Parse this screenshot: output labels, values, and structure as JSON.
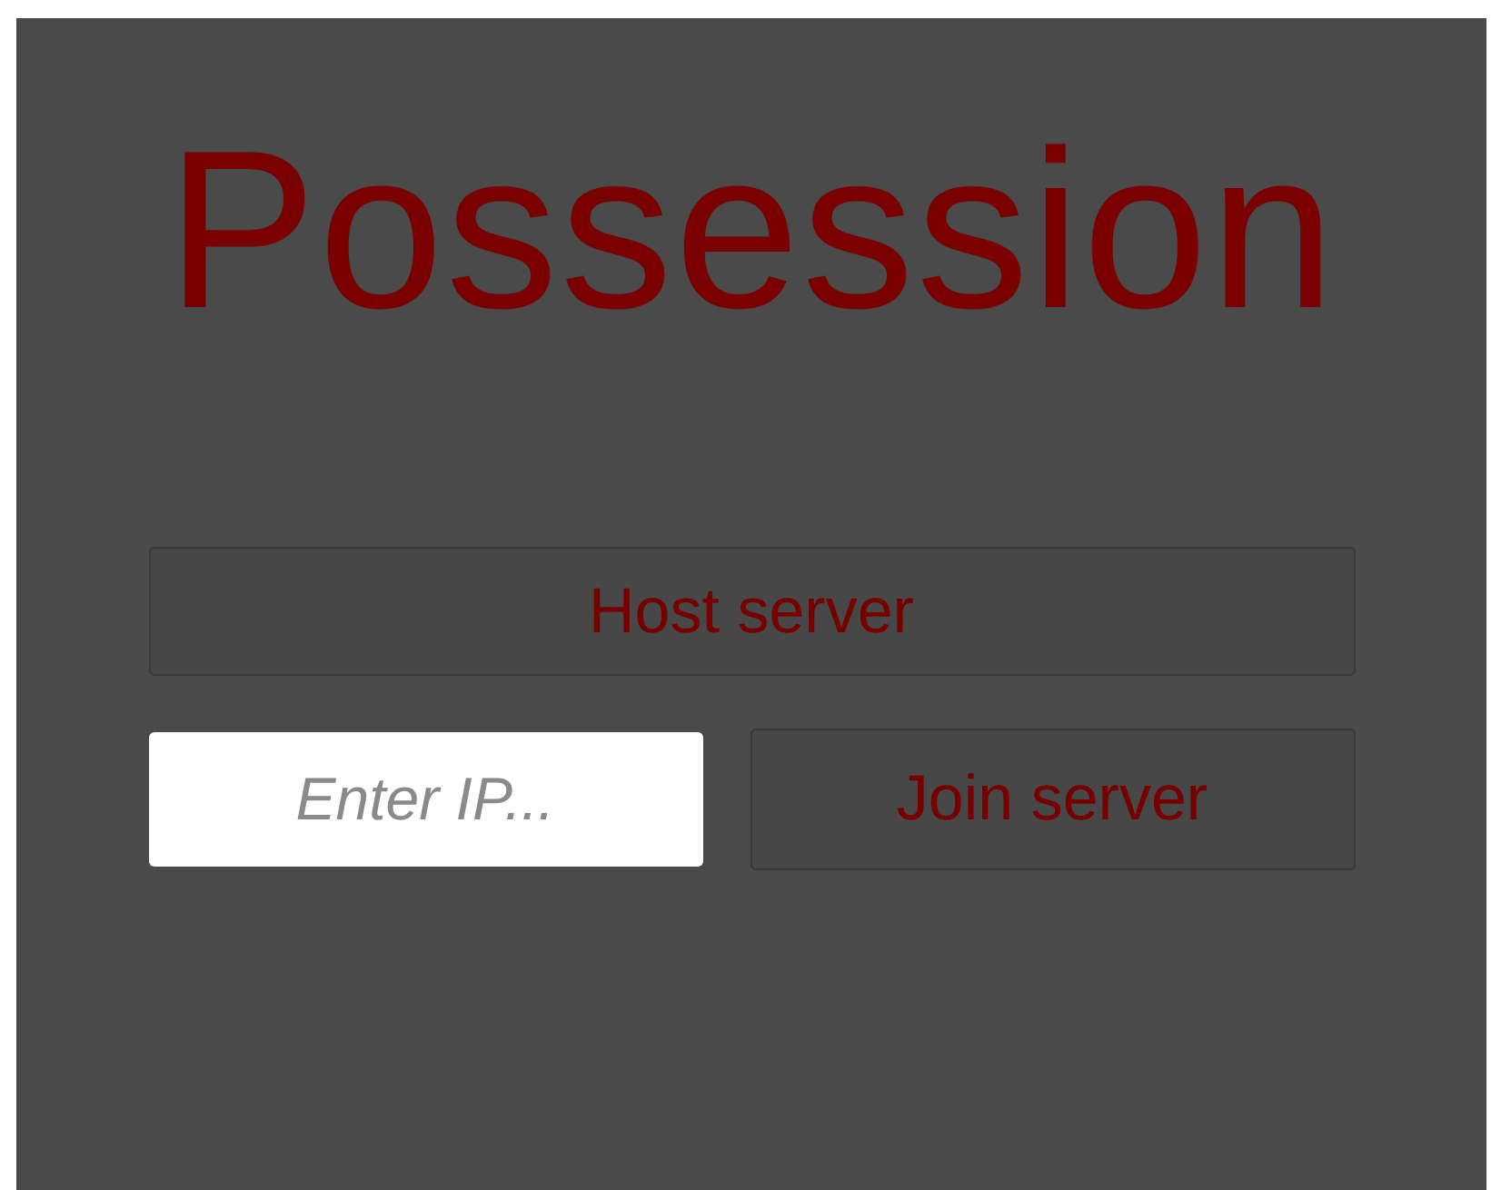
{
  "title": "Possession",
  "host_button": {
    "label": "Host server"
  },
  "ip_field": {
    "placeholder": "Enter IP..."
  },
  "join_button": {
    "label": "Join server"
  }
}
